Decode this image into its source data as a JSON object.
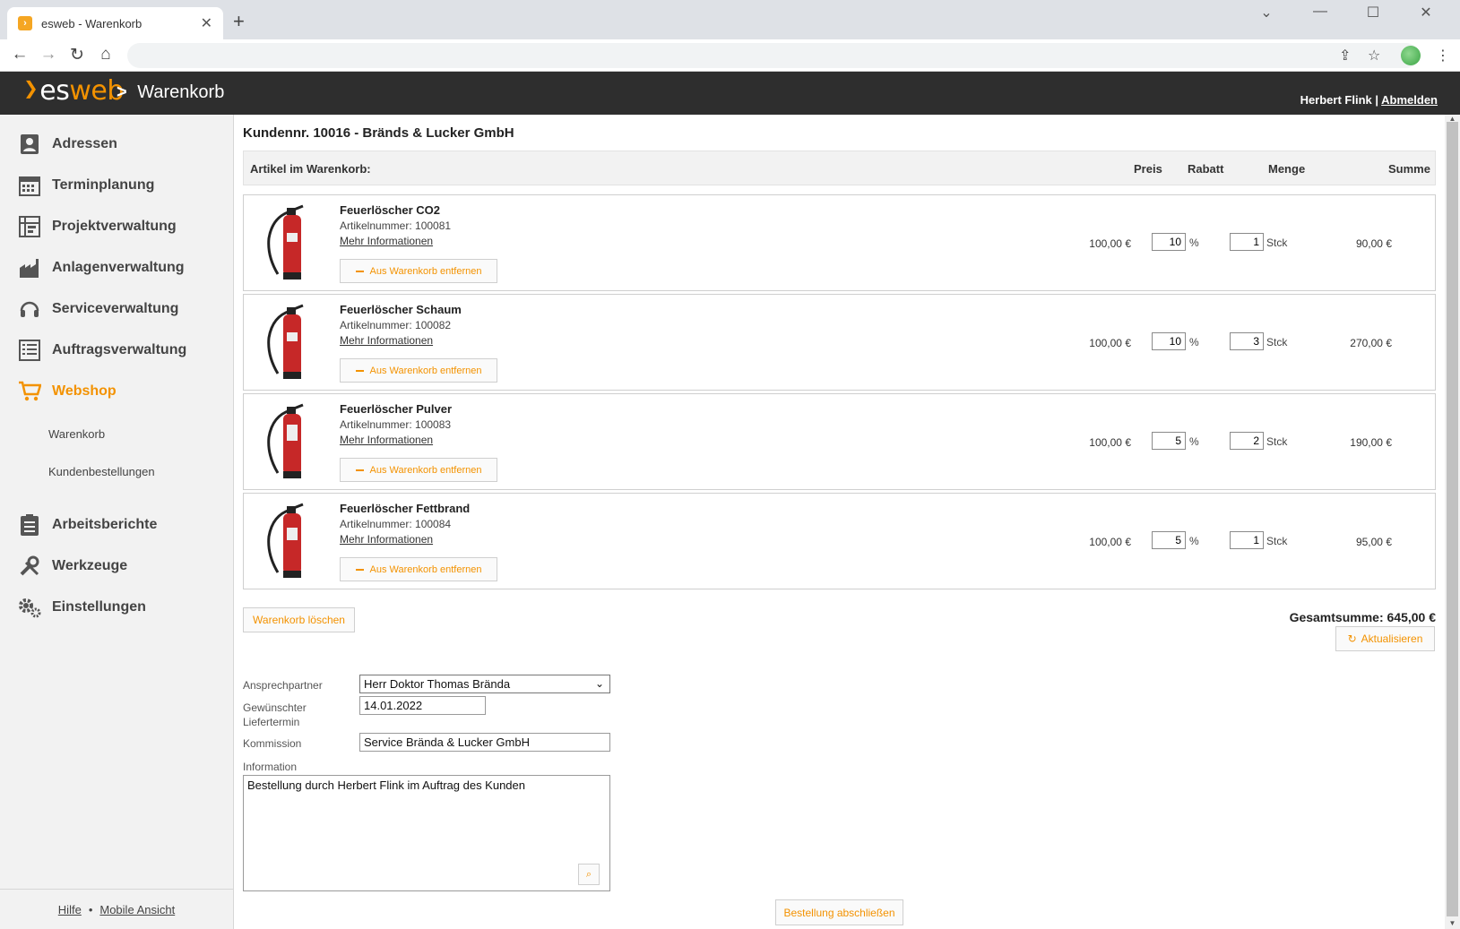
{
  "browser": {
    "tab_title": "esweb - Warenkorb",
    "tab_close": "✕",
    "new_tab": "+",
    "url": ""
  },
  "header": {
    "logo_es": "es",
    "logo_web": "web",
    "crumb_sep": ">",
    "page": "Warenkorb",
    "user": "Herbert Flink",
    "divider": "|",
    "logout": "Abmelden"
  },
  "sidebar": {
    "items": [
      {
        "label": "Adressen",
        "icon": "address-book-icon"
      },
      {
        "label": "Terminplanung",
        "icon": "calendar-icon"
      },
      {
        "label": "Projektverwaltung",
        "icon": "project-icon"
      },
      {
        "label": "Anlagenverwaltung",
        "icon": "factory-icon"
      },
      {
        "label": "Serviceverwaltung",
        "icon": "headset-icon"
      },
      {
        "label": "Auftragsverwaltung",
        "icon": "list-icon"
      },
      {
        "label": "Webshop",
        "icon": "cart-icon"
      },
      {
        "label": "Arbeitsberichte",
        "icon": "clipboard-icon"
      },
      {
        "label": "Werkzeuge",
        "icon": "tools-icon"
      },
      {
        "label": "Einstellungen",
        "icon": "gears-icon"
      }
    ],
    "sub_items": [
      "Warenkorb",
      "Kundenbestellungen"
    ],
    "footer": {
      "help": "Hilfe",
      "dot": "•",
      "mobile": "Mobile Ansicht"
    }
  },
  "cart": {
    "customer_title": "Kundennr. 10016 - Bränds & Lucker GmbH",
    "columns": {
      "articles": "Artikel im Warenkorb:",
      "price": "Preis",
      "discount": "Rabatt",
      "quantity": "Menge",
      "sum": "Summe"
    },
    "remove_label": "Aus Warenkorb entfernen",
    "more_info": "Mehr Informationen",
    "percent": "%",
    "unit": "Stck",
    "items": [
      {
        "name": "Feuerlöscher CO2",
        "artnr": "Artikelnummer: 100081",
        "price": "100,00 €",
        "discount": "10",
        "qty": "1",
        "sum": "90,00 €"
      },
      {
        "name": "Feuerlöscher Schaum",
        "artnr": "Artikelnummer: 100082",
        "price": "100,00 €",
        "discount": "10",
        "qty": "3",
        "sum": "270,00 €"
      },
      {
        "name": "Feuerlöscher Pulver",
        "artnr": "Artikelnummer: 100083",
        "price": "100,00 €",
        "discount": "5",
        "qty": "2",
        "sum": "190,00 €"
      },
      {
        "name": "Feuerlöscher Fettbrand",
        "artnr": "Artikelnummer: 100084",
        "price": "100,00 €",
        "discount": "5",
        "qty": "1",
        "sum": "95,00 €"
      }
    ],
    "clear_label": "Warenkorb löschen",
    "total_label": "Gesamtsumme: 645,00 €",
    "refresh_label": "Aktualisieren"
  },
  "form": {
    "contact_label": "Ansprechpartner",
    "contact_value": "Herr Doktor Thomas Brända",
    "date_label_1": "Gewünschter",
    "date_label_2": "Liefertermin",
    "date_value": "14.01.2022",
    "commission_label": "Kommission",
    "commission_value": "Service Brända & Lucker GmbH",
    "info_label": "Information",
    "info_value": "Bestellung durch Herbert Flink im Auftrag des Kunden",
    "submit_label": "Bestellung abschließen"
  },
  "colors": {
    "accent": "#f39200",
    "header_bg": "#2e2e2e",
    "sidebar_bg": "#f2f2f2"
  }
}
